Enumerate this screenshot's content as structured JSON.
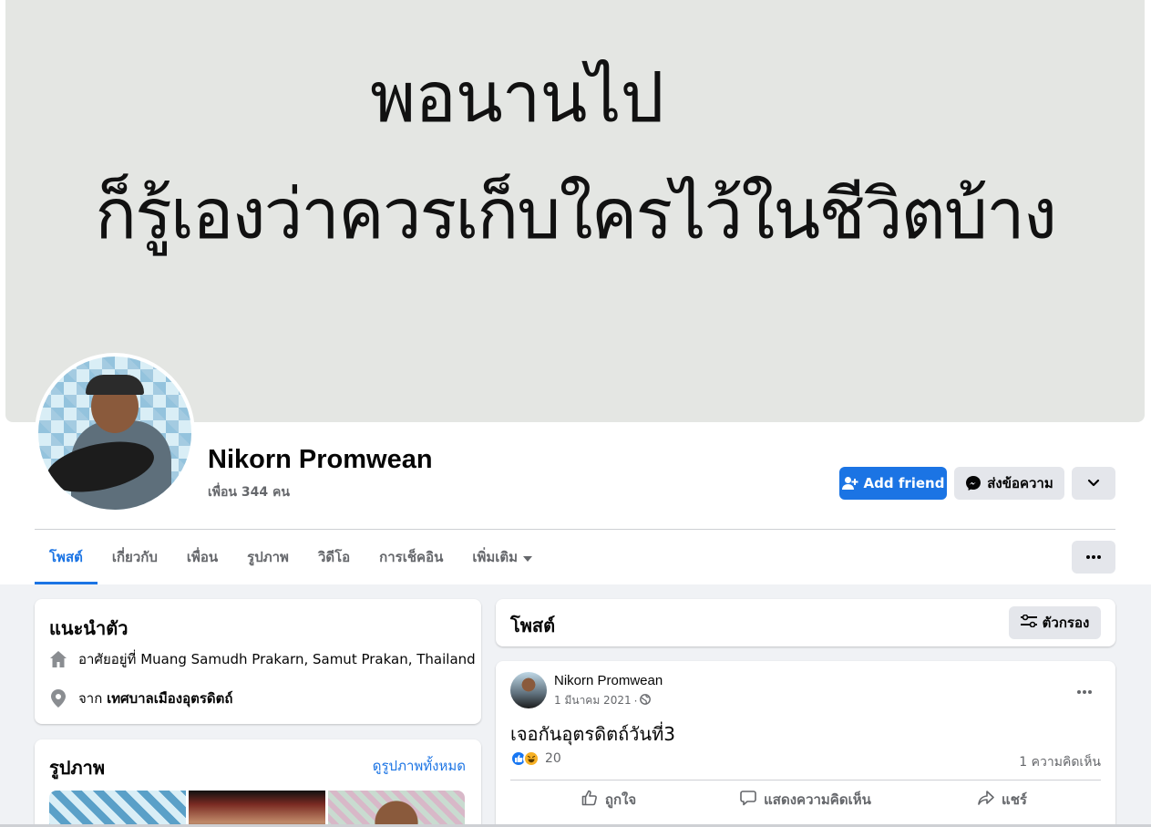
{
  "cover": {
    "line1": "พอนานไป",
    "line2": "ก็รู้เองว่าควรเก็บใครไว้ในชีวิตบ้าง"
  },
  "profile": {
    "name": "Nikorn Promwean",
    "friends": "เพื่อน 344 คน"
  },
  "actions": {
    "add_friend": "Add friend",
    "message": "ส่งข้อความ"
  },
  "tabs": [
    {
      "label": "โพสต์",
      "active": true
    },
    {
      "label": "เกี่ยวกับ"
    },
    {
      "label": "เพื่อน"
    },
    {
      "label": "รูปภาพ"
    },
    {
      "label": "วิดีโอ"
    },
    {
      "label": "การเช็คอิน"
    },
    {
      "label": "เพิ่มเติม"
    }
  ],
  "intro": {
    "title": "แนะนำตัว",
    "lives_prefix": "อาศัยอยู่ที่",
    "lives_value": "Muang Samudh Prakarn, Samut Prakan, Thailand",
    "from_prefix": "จาก",
    "from_value": "เทศบาลเมืองอุตรดิตถ์"
  },
  "photos": {
    "title": "รูปภาพ",
    "see_all": "ดูรูปภาพทั้งหมด"
  },
  "posts": {
    "title": "โพสต์",
    "filter": "ตัวกรอง"
  },
  "post": {
    "author": "Nikorn Promwean",
    "date": "1 มีนาคม 2021",
    "dot": "·",
    "text": "เจอกันอุตรดิตถ์วันที่3",
    "reaction_count": "20",
    "comment_count": "1 ความคิดเห็น",
    "like": "ถูกใจ",
    "comment": "แสดงความคิดเห็น",
    "share": "แชร์"
  },
  "colors": {
    "accent": "#1b74e4",
    "button_gray": "#e4e6eb",
    "background": "#f0f2f5"
  }
}
